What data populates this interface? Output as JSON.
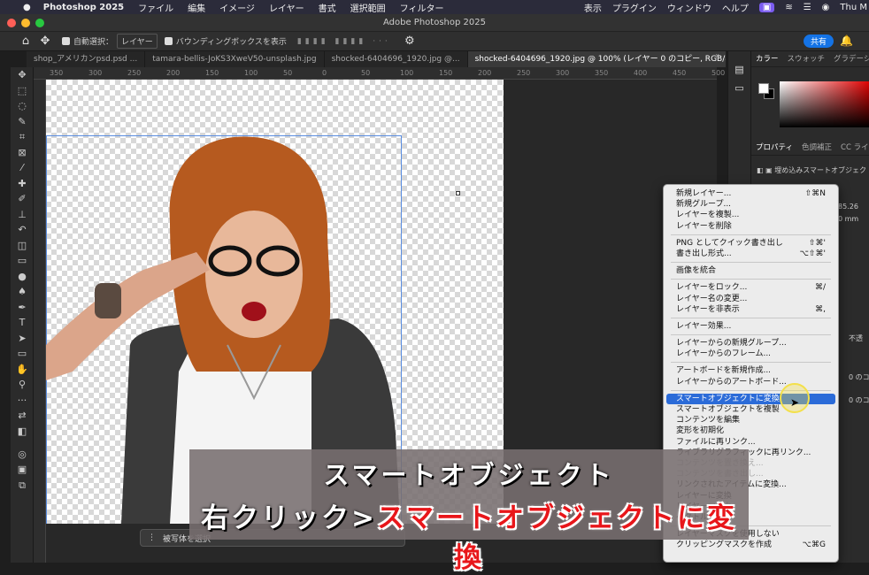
{
  "macbar": {
    "apple": "",
    "app": "Photoshop 2025",
    "menus": [
      "ファイル",
      "編集",
      "イメージ",
      "レイヤー",
      "書式",
      "選択範囲",
      "フィルター"
    ],
    "right": [
      "表示",
      "プラグイン",
      "ウィンドウ",
      "ヘルプ"
    ],
    "user": "Thu M"
  },
  "titlebar": {
    "title": "Adobe Photoshop 2025"
  },
  "optbar": {
    "autoselect_label": "自動選択：",
    "autoselect_value": "レイヤー",
    "bbox_label": "バウンディングボックスを表示",
    "share": "共有"
  },
  "tabs": [
    {
      "label": "shop_アメリカンpsd.psd ..."
    },
    {
      "label": "tamara-bellis-JoKS3XweV50-unsplash.jpg"
    },
    {
      "label": "shocked-6404696_1920.jpg @..."
    },
    {
      "label": "shocked-6404696_1920.jpg @ 100% (レイヤー 0 のコピー, RGB/8#) *"
    }
  ],
  "ruler": [
    "350",
    "300",
    "250",
    "200",
    "150",
    "100",
    "50",
    "0",
    "50",
    "100",
    "150",
    "200",
    "250",
    "300",
    "350",
    "400",
    "450",
    "500"
  ],
  "rightpanel": {
    "tabs1": [
      "カラー",
      "スウォッチ",
      "グラデーショ"
    ],
    "tabs2": [
      "プロパティ",
      "色調補正",
      "CC ライ"
    ],
    "smartobj": "埋め込みスマートオブジェク",
    "v1": "85.26",
    "v2": "0 mm",
    "layer1": "0 のコ",
    "layer2": "0 のコ",
    "opacity": "不透"
  },
  "menu": {
    "items": [
      {
        "label": "新規レイヤー...",
        "sc": "⇧⌘N"
      },
      {
        "label": "新規グループ...",
        "sc": ""
      },
      {
        "label": "レイヤーを複製...",
        "sc": ""
      },
      {
        "label": "レイヤーを削除",
        "sc": ""
      },
      {
        "sep": true
      },
      {
        "label": "PNG としてクイック書き出し",
        "sc": "⇧⌘'"
      },
      {
        "label": "書き出し形式...",
        "sc": "⌥⇧⌘'"
      },
      {
        "sep": true
      },
      {
        "label": "画像を統合",
        "sc": ""
      },
      {
        "sep": true
      },
      {
        "label": "レイヤーをロック...",
        "sc": "⌘/"
      },
      {
        "label": "レイヤー名の変更...",
        "sc": ""
      },
      {
        "label": "レイヤーを非表示",
        "sc": "⌘,"
      },
      {
        "sep": true
      },
      {
        "label": "レイヤー効果...",
        "sc": ""
      },
      {
        "sep": true
      },
      {
        "label": "レイヤーからの新規グループ...",
        "sc": ""
      },
      {
        "label": "レイヤーからのフレーム...",
        "sc": ""
      },
      {
        "sep": true
      },
      {
        "label": "アートボードを新規作成...",
        "sc": ""
      },
      {
        "label": "レイヤーからのアートボード...",
        "sc": ""
      },
      {
        "sep": true
      },
      {
        "label": "スマートオブジェクトに変換",
        "sc": "",
        "hl": true
      },
      {
        "label": "スマートオブジェクトを複製",
        "sc": ""
      },
      {
        "label": "コンテンツを編集",
        "sc": ""
      },
      {
        "label": "変形を初期化",
        "sc": ""
      },
      {
        "label": "ファイルに再リンク...",
        "sc": ""
      },
      {
        "label": "ライブラリグラフィックに再リンク...",
        "sc": ""
      },
      {
        "label": "コンテンツを置き換え...",
        "sc": "",
        "dim": true
      },
      {
        "label": "コンテンツを書き出し...",
        "sc": "",
        "dim": true
      },
      {
        "label": "リンクされたアイテムに変換...",
        "sc": ""
      },
      {
        "label": "レイヤーに変換",
        "sc": ""
      },
      {
        "label": "レイヤーマスク",
        "sc": ""
      },
      {
        "label": "ベクトルマスク",
        "sc": ""
      },
      {
        "sep": true
      },
      {
        "label": "レイヤーマスクを使用しない",
        "sc": ""
      },
      {
        "label": "クリッピングマスクを作成",
        "sc": "⌥⌘G"
      }
    ]
  },
  "ctxbar": {
    "subject": "被写体を選択"
  },
  "caption": {
    "line1": "スマートオブジェクト",
    "line2_white": "右クリック>",
    "line2_red": "スマートオブジェクトに変換"
  }
}
